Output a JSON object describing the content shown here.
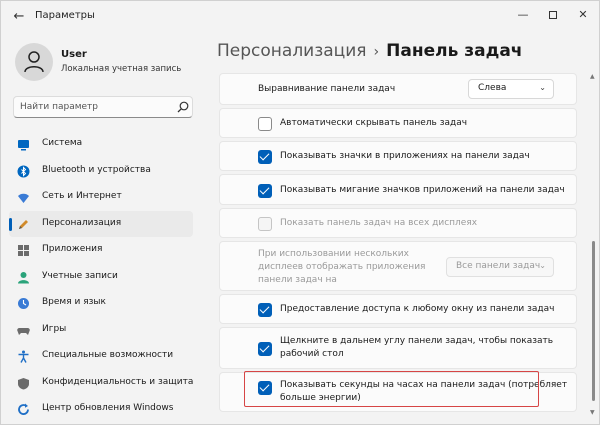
{
  "window": {
    "title": "Параметры",
    "back": "←",
    "minimize": "—",
    "close": "✕"
  },
  "user": {
    "name": "User",
    "subtitle": "Локальная учетная запись"
  },
  "search": {
    "placeholder": "Найти параметр"
  },
  "sidebar": {
    "items": [
      {
        "label": "Система",
        "icon": "monitor-icon",
        "color": "#0067c0"
      },
      {
        "label": "Bluetooth и устройства",
        "icon": "bluetooth-icon",
        "color": "#0067c0"
      },
      {
        "label": "Сеть и Интернет",
        "icon": "wifi-icon",
        "color": "#3a7bd5"
      },
      {
        "label": "Персонализация",
        "icon": "pen-icon",
        "color": "#d08a2a",
        "active": true
      },
      {
        "label": "Приложения",
        "icon": "apps-icon",
        "color": "#6b6b6b"
      },
      {
        "label": "Учетные записи",
        "icon": "person-icon",
        "color": "#2aa37a"
      },
      {
        "label": "Время и язык",
        "icon": "globe-clock-icon",
        "color": "#3a7bd5"
      },
      {
        "label": "Игры",
        "icon": "gamepad-icon",
        "color": "#6b6b6b"
      },
      {
        "label": "Специальные возможности",
        "icon": "accessibility-icon",
        "color": "#1f6fc6"
      },
      {
        "label": "Конфиденциальность и защита",
        "icon": "shield-icon",
        "color": "#6b6b6b"
      },
      {
        "label": "Центр обновления Windows",
        "icon": "refresh-icon",
        "color": "#1f6fc6"
      }
    ]
  },
  "header": {
    "parent": "Персонализация",
    "separator": "›",
    "current": "Панель задач"
  },
  "settings": {
    "alignment": {
      "label": "Выравнивание панели задач",
      "value": "Слева"
    },
    "auto_hide": {
      "label": "Автоматически скрывать панель задач",
      "checked": false
    },
    "show_badges": {
      "label": "Показывать значки в приложениях на панели задач",
      "checked": true
    },
    "show_flashing": {
      "label": "Показывать мигание значков приложений на панели задач",
      "checked": true
    },
    "all_displays": {
      "label": "Показать панель задач на всех дисплеях",
      "checked": false,
      "disabled": true
    },
    "multi_display": {
      "line1": "При использовании нескольких",
      "line2": "дисплеев отображать приложения",
      "line3": "панели задач на",
      "value": "Все панели задач"
    },
    "share_window": {
      "label": "Предоставление доступа к любому окну из панели задач",
      "checked": true
    },
    "far_corner": {
      "line1": "Щелкните в дальнем углу панели задач, чтобы показать",
      "line2": "рабочий стол",
      "checked": true
    },
    "show_seconds": {
      "line1": "Показывать секунды на часах на панели задач (потребляет",
      "line2": "больше энергии)",
      "checked": true
    }
  },
  "colors": {
    "accent": "#005fb8",
    "highlight": "#d64545"
  }
}
